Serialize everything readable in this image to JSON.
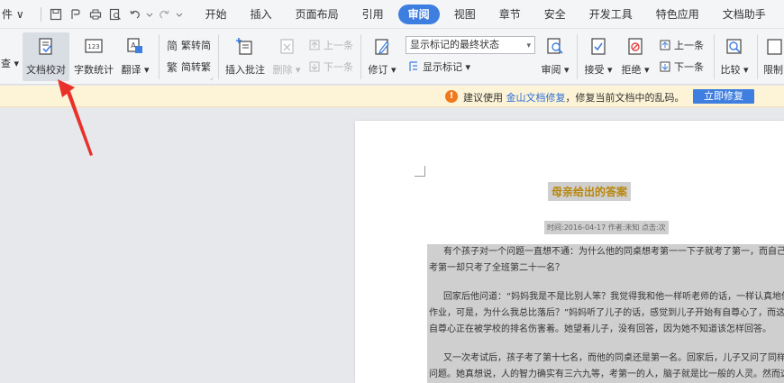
{
  "menubar": {
    "file_label": "件 ∨",
    "tabs": [
      {
        "label": "开始",
        "active": false
      },
      {
        "label": "插入",
        "active": false
      },
      {
        "label": "页面布局",
        "active": false
      },
      {
        "label": "引用",
        "active": false
      },
      {
        "label": "审阅",
        "active": true
      },
      {
        "label": "视图",
        "active": false
      },
      {
        "label": "章节",
        "active": false
      },
      {
        "label": "安全",
        "active": false
      },
      {
        "label": "开发工具",
        "active": false
      },
      {
        "label": "特色应用",
        "active": false
      },
      {
        "label": "文档助手",
        "active": false
      }
    ]
  },
  "ribbon": {
    "spell_check": "查 ▾",
    "doc_proofread": "文档校对",
    "word_count": "字数统计",
    "translate": "翻译 ▾",
    "trad_to_simp": "繁转简",
    "simp_to_trad": "简转繁",
    "insert_comment": "插入批注",
    "delete": "删除 ▾",
    "prev_comment": "上一条",
    "next_comment": "下一条",
    "track_changes": "修订 ▾",
    "display_mode": "显示标记的最终状态",
    "show_markup": "显示标记 ▾",
    "review": "审阅 ▾",
    "accept": "接受 ▾",
    "reject": "拒绝 ▾",
    "prev_change": "上一条",
    "next_change": "下一条",
    "compare": "比较 ▾",
    "restrict": "限制"
  },
  "notice": {
    "prefix": "建议使用",
    "link": "金山文档修复",
    "suffix": "，修复当前文档中的乱码。",
    "button": "立即修复"
  },
  "document": {
    "title": "母亲给出的答案",
    "meta": "时间:2016-04-17  作者:未知  点击:次",
    "lines": [
      {
        "text": "有个孩子对一个问题一直想不通：为什么他的同桌想考第一一下子就考了第一，而自己想",
        "indent": true
      },
      {
        "text": "考第一却只考了全班第二十一名？",
        "indent": false
      },
      {
        "text": "",
        "indent": false
      },
      {
        "text": "回家后他问道：“妈妈我是不是比别人笨？我觉得我和他一样听老师的话，一样认真地做",
        "indent": true
      },
      {
        "text": "作业，可是，为什么我总比落后？”妈妈听了儿子的话，感觉到儿子开始有自尊心了，而这种",
        "indent": false
      },
      {
        "text": "自尊心正在被学校的排名伤害着。她望着儿子，没有回答，因为她不知道该怎样回答。",
        "indent": false
      },
      {
        "text": "",
        "indent": false
      },
      {
        "text": "又一次考试后，孩子考了第十七名，而他的同桌还是第一名。回家后，儿子又问了同样的",
        "indent": true
      },
      {
        "text": "问题。她真想说，人的智力确实有三六九等，考第一的人，脑子就是比一般的人灵。然而这样",
        "indent": false
      }
    ]
  },
  "colors": {
    "accent": "#3e7ee0",
    "notice_bg": "#fdf3d6",
    "warn": "#f0781e",
    "arrow": "#e8312a",
    "title": "#b8860b"
  }
}
